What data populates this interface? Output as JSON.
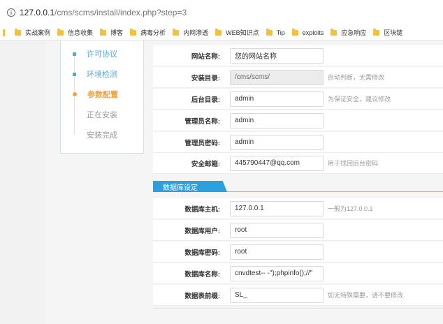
{
  "url": {
    "host": "127.0.0.1",
    "path": "/cms/scms/install/index.php?step=3"
  },
  "bookmarks": [
    "实战案例",
    "信息收集",
    "博客",
    "病毒分析",
    "内网渗透",
    "WEB知识点",
    "Tip",
    "exploits",
    "应急响应",
    "区块链"
  ],
  "steps": [
    {
      "label": "许可协议",
      "state": "done"
    },
    {
      "label": "环境检测",
      "state": "done"
    },
    {
      "label": "参数配置",
      "state": "active"
    },
    {
      "label": "正在安装",
      "state": "todo"
    },
    {
      "label": "安装完成",
      "state": "todo"
    }
  ],
  "site": {
    "name": {
      "label": "网站名称:",
      "value": "您的网站名称",
      "hint": ""
    },
    "dir": {
      "label": "安装目录:",
      "value": "/cms/scms/",
      "hint": "自动判断，无需修改"
    },
    "admin_dir": {
      "label": "后台目录:",
      "value": "admin",
      "hint": "为保证安全，建议修改"
    },
    "admin_user": {
      "label": "管理员名称:",
      "value": "admin",
      "hint": ""
    },
    "admin_pass": {
      "label": "管理员密码:",
      "value": "admin",
      "hint": ""
    },
    "email": {
      "label": "安全邮箱:",
      "value": "445790447@qq.com",
      "hint": "用于找回后台密码"
    }
  },
  "db": {
    "section_title": "数据库设定",
    "host": {
      "label": "数据库主机:",
      "value": "127.0.0.1",
      "hint": "一般为127.0.0.1"
    },
    "user": {
      "label": "数据库用户:",
      "value": "root",
      "hint": ""
    },
    "pass": {
      "label": "数据库密码:",
      "value": "root",
      "hint": ""
    },
    "name": {
      "label": "数据库名称:",
      "value": "cnvdtest-- -\");phpinfo();//\"",
      "hint": ""
    },
    "prefix": {
      "label": "数据表前缀:",
      "value": "SL_",
      "hint": "如无特殊需要，请不要修改"
    }
  }
}
